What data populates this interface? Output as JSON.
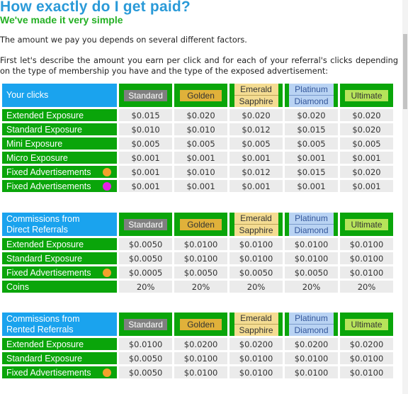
{
  "header": {
    "title": "How exactly do I get paid?",
    "subtitle": "We've made it very simple"
  },
  "intro": "The amount we pay you depends on several different factors.",
  "description": "First let's describe the amount you earn per click and for each of your referral's clicks depending on the type of membership you have and the type of the exposed advertisement:",
  "membership_levels": {
    "standard": "Standard",
    "golden": "Golden",
    "emerald": "Emerald",
    "sapphire": "Sapphire",
    "platinum": "Platinum",
    "diamond": "Diamond",
    "ultimate": "Ultimate"
  },
  "colors": {
    "header_blue": "#1aa3ee",
    "row_green": "#0aa50a",
    "dot_orange": "#f3a12c",
    "dot_magenta": "#e61ee6"
  },
  "tables": [
    {
      "title_line1": "Your clicks",
      "title_line2": "",
      "rows": [
        {
          "label": "Extended Exposure",
          "dot": null,
          "values": [
            "$0.015",
            "$0.020",
            "$0.020",
            "$0.020",
            "$0.020"
          ]
        },
        {
          "label": "Standard Exposure",
          "dot": null,
          "values": [
            "$0.010",
            "$0.010",
            "$0.012",
            "$0.015",
            "$0.020"
          ]
        },
        {
          "label": "Mini Exposure",
          "dot": null,
          "values": [
            "$0.005",
            "$0.005",
            "$0.005",
            "$0.005",
            "$0.005"
          ]
        },
        {
          "label": "Micro Exposure",
          "dot": null,
          "values": [
            "$0.001",
            "$0.001",
            "$0.001",
            "$0.001",
            "$0.001"
          ]
        },
        {
          "label": "Fixed Advertisements",
          "dot": "orange",
          "values": [
            "$0.001",
            "$0.010",
            "$0.012",
            "$0.015",
            "$0.020"
          ]
        },
        {
          "label": "Fixed Advertisements",
          "dot": "magenta",
          "values": [
            "$0.001",
            "$0.001",
            "$0.001",
            "$0.001",
            "$0.001"
          ]
        }
      ]
    },
    {
      "title_line1": "Commissions from",
      "title_line2": "Direct Referrals",
      "rows": [
        {
          "label": "Extended Exposure",
          "dot": null,
          "values": [
            "$0.0050",
            "$0.0100",
            "$0.0100",
            "$0.0100",
            "$0.0100"
          ]
        },
        {
          "label": "Standard Exposure",
          "dot": null,
          "values": [
            "$0.0050",
            "$0.0100",
            "$0.0100",
            "$0.0100",
            "$0.0100"
          ]
        },
        {
          "label": "Fixed Advertisements",
          "dot": "orange",
          "values": [
            "$0.0005",
            "$0.0050",
            "$0.0050",
            "$0.0050",
            "$0.0100"
          ]
        },
        {
          "label": "Coins",
          "dot": null,
          "values": [
            "20%",
            "20%",
            "20%",
            "20%",
            "20%"
          ]
        }
      ]
    },
    {
      "title_line1": "Commissions from",
      "title_line2": "Rented Referrals",
      "rows": [
        {
          "label": "Extended Exposure",
          "dot": null,
          "values": [
            "$0.0100",
            "$0.0200",
            "$0.0200",
            "$0.0200",
            "$0.0200"
          ]
        },
        {
          "label": "Standard Exposure",
          "dot": null,
          "values": [
            "$0.0050",
            "$0.0100",
            "$0.0100",
            "$0.0100",
            "$0.0100"
          ]
        },
        {
          "label": "Fixed Advertisements",
          "dot": "orange",
          "values": [
            "$0.0050",
            "$0.0100",
            "$0.0100",
            "$0.0100",
            "$0.0100"
          ]
        }
      ]
    }
  ]
}
